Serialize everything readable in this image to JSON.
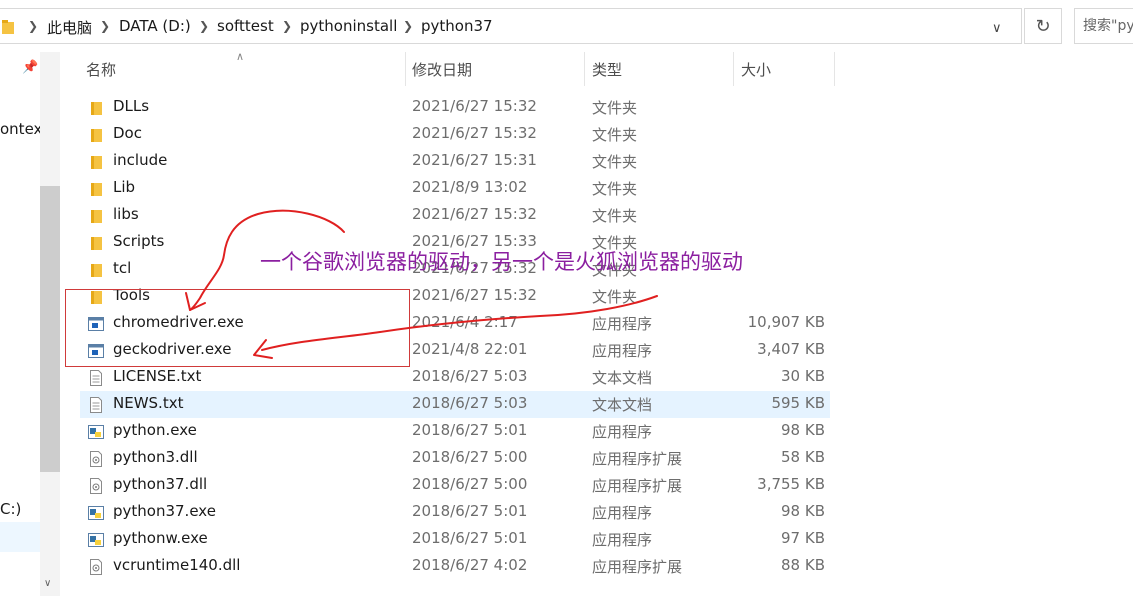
{
  "address_bar": {
    "breadcrumbs": [
      "此电脑",
      "DATA (D:)",
      "softtest",
      "pythoninstall",
      "python37"
    ],
    "search_placeholder": "搜索\"py"
  },
  "nav_pane": {
    "partial_items": [
      "ontex",
      "C:)"
    ]
  },
  "columns": {
    "name": "名称",
    "date": "修改日期",
    "type": "类型",
    "size": "大小"
  },
  "files": [
    {
      "name": "DLLs",
      "date": "2021/6/27 15:32",
      "type": "文件夹",
      "size": "",
      "icon": "folder-icon"
    },
    {
      "name": "Doc",
      "date": "2021/6/27 15:32",
      "type": "文件夹",
      "size": "",
      "icon": "folder-icon"
    },
    {
      "name": "include",
      "date": "2021/6/27 15:31",
      "type": "文件夹",
      "size": "",
      "icon": "folder-icon"
    },
    {
      "name": "Lib",
      "date": "2021/8/9 13:02",
      "type": "文件夹",
      "size": "",
      "icon": "folder-icon"
    },
    {
      "name": "libs",
      "date": "2021/6/27 15:32",
      "type": "文件夹",
      "size": "",
      "icon": "folder-icon"
    },
    {
      "name": "Scripts",
      "date": "2021/6/27 15:33",
      "type": "文件夹",
      "size": "",
      "icon": "folder-icon"
    },
    {
      "name": "tcl",
      "date": "2021/6/27 15:32",
      "type": "文件夹",
      "size": "",
      "icon": "folder-icon"
    },
    {
      "name": "Tools",
      "date": "2021/6/27 15:32",
      "type": "文件夹",
      "size": "",
      "icon": "folder-icon"
    },
    {
      "name": "chromedriver.exe",
      "date": "2021/6/4 2:17",
      "type": "应用程序",
      "size": "10,907 KB",
      "icon": "exe-icon"
    },
    {
      "name": "geckodriver.exe",
      "date": "2021/4/8 22:01",
      "type": "应用程序",
      "size": "3,407 KB",
      "icon": "exe-icon"
    },
    {
      "name": "LICENSE.txt",
      "date": "2018/6/27 5:03",
      "type": "文本文档",
      "size": "30 KB",
      "icon": "text-file-icon"
    },
    {
      "name": "NEWS.txt",
      "date": "2018/6/27 5:03",
      "type": "文本文档",
      "size": "595 KB",
      "icon": "text-file-icon"
    },
    {
      "name": "python.exe",
      "date": "2018/6/27 5:01",
      "type": "应用程序",
      "size": "98 KB",
      "icon": "python-icon"
    },
    {
      "name": "python3.dll",
      "date": "2018/6/27 5:00",
      "type": "应用程序扩展",
      "size": "58 KB",
      "icon": "dll-icon"
    },
    {
      "name": "python37.dll",
      "date": "2018/6/27 5:00",
      "type": "应用程序扩展",
      "size": "3,755 KB",
      "icon": "dll-icon"
    },
    {
      "name": "python37.exe",
      "date": "2018/6/27 5:01",
      "type": "应用程序",
      "size": "98 KB",
      "icon": "python-icon"
    },
    {
      "name": "pythonw.exe",
      "date": "2018/6/27 5:01",
      "type": "应用程序",
      "size": "97 KB",
      "icon": "python-icon"
    },
    {
      "name": "vcruntime140.dll",
      "date": "2018/6/27 4:02",
      "type": "应用程序扩展",
      "size": "88 KB",
      "icon": "dll-icon"
    }
  ],
  "highlighted_file": "NEWS.txt",
  "annotation": {
    "text": "一个谷歌浏览器的驱动，另一个是火狐浏览器的驱动",
    "text_color": "#8b1fa0",
    "ink_color": "#e02020"
  }
}
